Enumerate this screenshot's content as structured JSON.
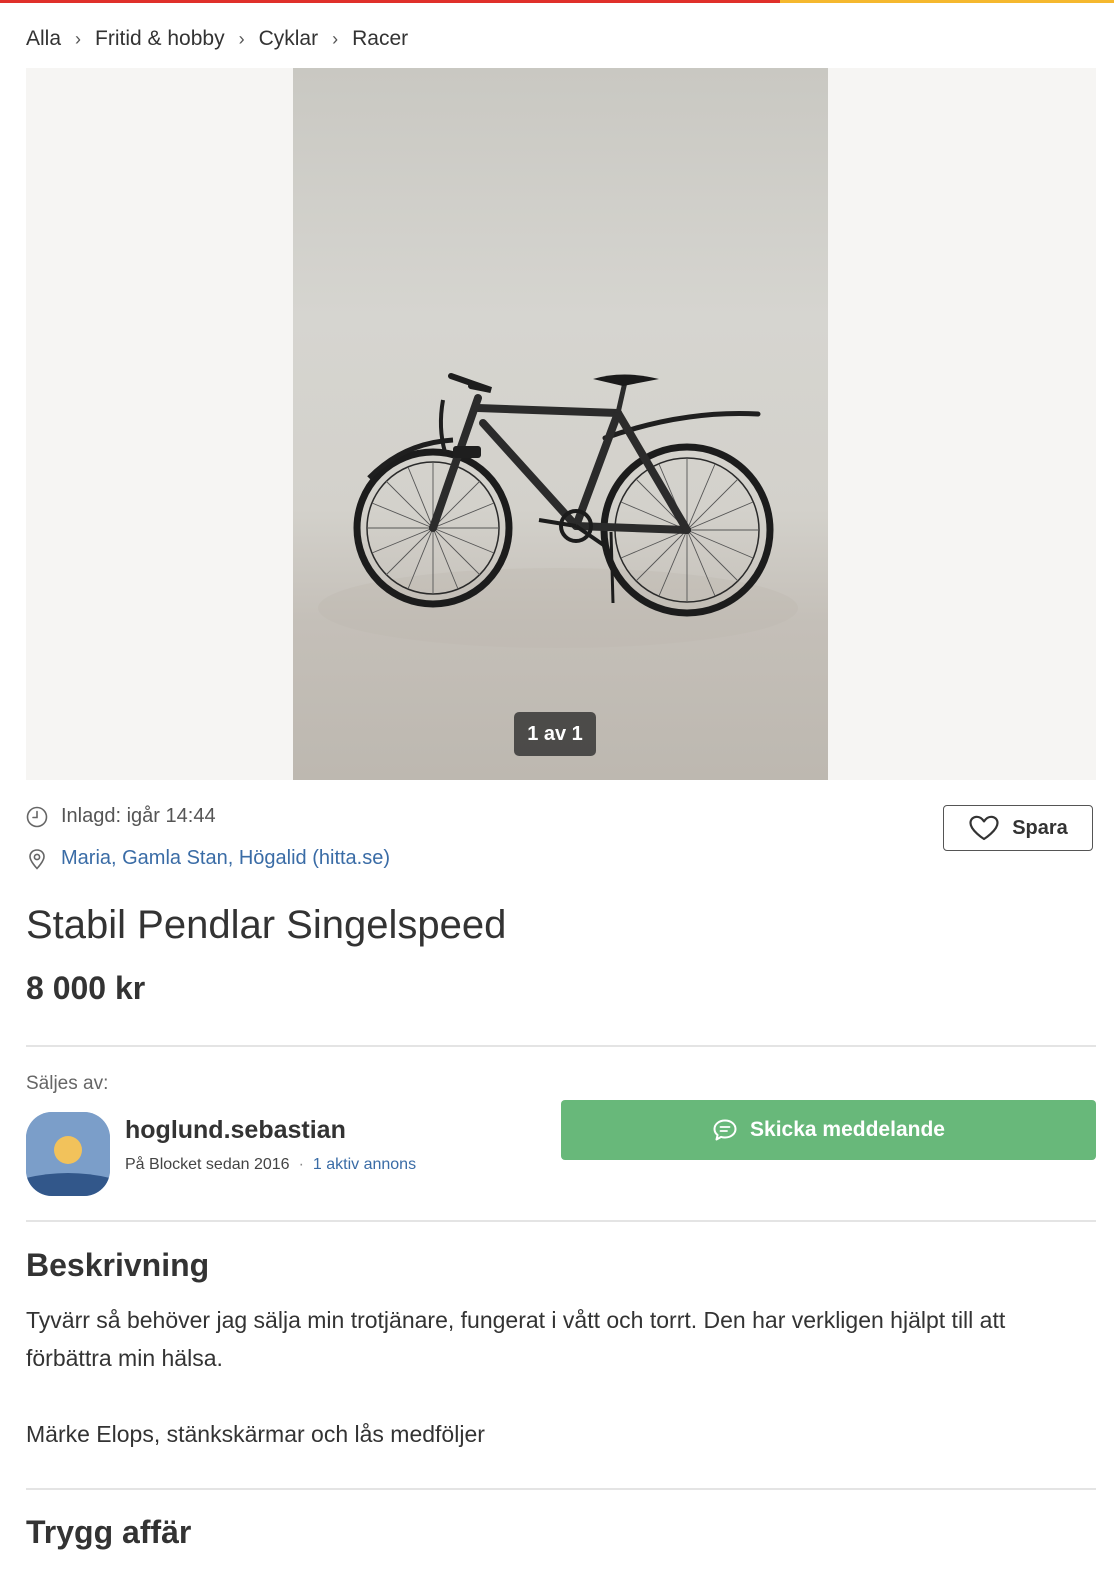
{
  "colors": {
    "brand_red": "#e0302a",
    "brand_yellow": "#f5b82e",
    "link_blue": "#3a6ca6",
    "cta_green": "#68b87a"
  },
  "breadcrumb": {
    "items": [
      {
        "label": "Alla"
      },
      {
        "label": "Fritid & hobby"
      },
      {
        "label": "Cyklar"
      },
      {
        "label": "Racer"
      }
    ],
    "separator": "›"
  },
  "gallery": {
    "counter": "1 av 1"
  },
  "listing": {
    "posted": "Inlagd: igår 14:44",
    "location": "Maria, Gamla Stan, Högalid (hitta.se)",
    "save_label": "Spara",
    "title": "Stabil Pendlar Singelspeed",
    "price": "8 000 kr"
  },
  "seller": {
    "label": "Säljes av:",
    "name": "hoglund.sebastian",
    "since": "På Blocket sedan 2016",
    "separator": "·",
    "active_ads": "1 aktiv annons",
    "message_button": "Skicka meddelande"
  },
  "description": {
    "heading": "Beskrivning",
    "paragraph1": "Tyvärr så behöver jag sälja min trotjänare, fungerat i vått och torrt. Den har verkligen hjälpt till att förbättra min hälsa.",
    "paragraph2": "Märke Elops, stänkskärmar och lås medföljer"
  },
  "safe_trade": {
    "heading": "Trygg affär"
  },
  "icons": {
    "posted": "clock-icon",
    "location": "location-pin-icon",
    "save": "heart-icon",
    "message": "chat-bubble-icon"
  }
}
